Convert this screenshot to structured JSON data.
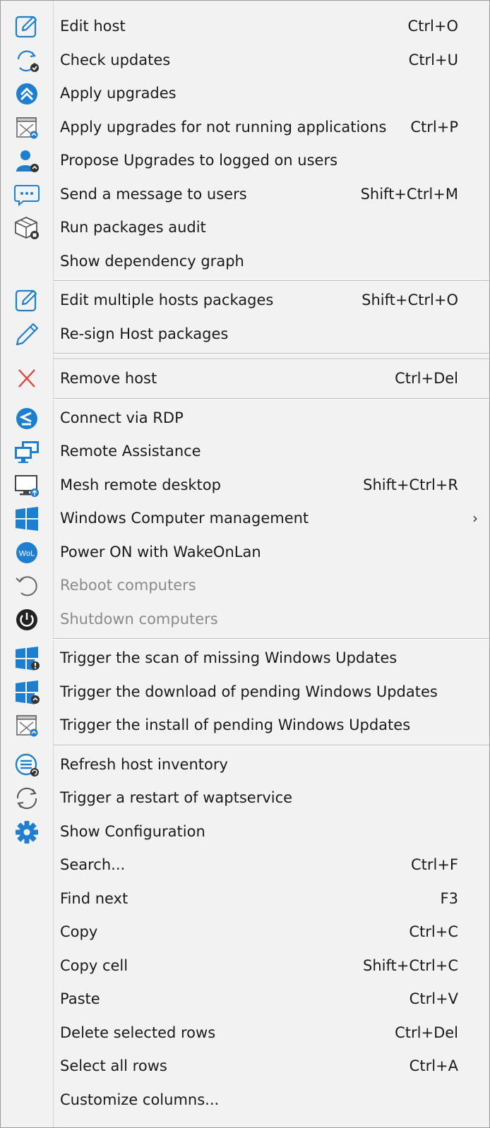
{
  "menu": {
    "items": [
      {
        "label": "Edit host",
        "shortcut": "Ctrl+O",
        "icon": "edit-icon"
      },
      {
        "label": "Check updates",
        "shortcut": "Ctrl+U",
        "icon": "check-updates-icon"
      },
      {
        "label": "Apply upgrades",
        "shortcut": "",
        "icon": "apply-upgrades-icon"
      },
      {
        "label": "Apply upgrades for not running applications",
        "shortcut": "Ctrl+P",
        "icon": "window-upgrade-icon"
      },
      {
        "label": "Propose Upgrades to logged on users",
        "shortcut": "",
        "icon": "user-upgrade-icon"
      },
      {
        "label": "Send a message to users",
        "shortcut": "Shift+Ctrl+M",
        "icon": "message-icon"
      },
      {
        "label": "Run packages audit",
        "shortcut": "",
        "icon": "package-audit-icon"
      },
      {
        "label": "Show dependency graph",
        "shortcut": "",
        "icon": ""
      },
      {
        "label": "Edit multiple hosts packages",
        "shortcut": "Shift+Ctrl+O",
        "icon": "edit-icon"
      },
      {
        "label": "Re-sign Host packages",
        "shortcut": "",
        "icon": "pencil-icon"
      },
      {
        "label": "Remove host",
        "shortcut": "Ctrl+Del",
        "icon": "remove-icon"
      },
      {
        "label": "Connect via RDP",
        "shortcut": "",
        "icon": "rdp-icon"
      },
      {
        "label": "Remote Assistance",
        "shortcut": "",
        "icon": "remote-assistance-icon"
      },
      {
        "label": "Mesh remote desktop",
        "shortcut": "Shift+Ctrl+R",
        "icon": "mesh-desktop-icon"
      },
      {
        "label": "Windows Computer management",
        "shortcut": "",
        "icon": "windows-icon",
        "submenu": "›"
      },
      {
        "label": "Power ON with WakeOnLan",
        "shortcut": "",
        "icon": "wol-icon",
        "icon_text": "WoL"
      },
      {
        "label": "Reboot computers",
        "shortcut": "",
        "icon": "reboot-icon",
        "disabled": true
      },
      {
        "label": "Shutdown computers",
        "shortcut": "",
        "icon": "power-icon",
        "disabled": true
      },
      {
        "label": "Trigger the scan of missing Windows Updates",
        "shortcut": "",
        "icon": "windows-scan-icon"
      },
      {
        "label": "Trigger the download of pending Windows Updates",
        "shortcut": "",
        "icon": "windows-download-icon"
      },
      {
        "label": "Trigger the install of pending Windows Updates",
        "shortcut": "",
        "icon": "window-upgrade-icon"
      },
      {
        "label": "Refresh host inventory",
        "shortcut": "",
        "icon": "refresh-inventory-icon"
      },
      {
        "label": "Trigger a restart of waptservice",
        "shortcut": "",
        "icon": "restart-icon"
      },
      {
        "label": "Show Configuration",
        "shortcut": "",
        "icon": "gear-icon"
      },
      {
        "label": "Search...",
        "shortcut": "Ctrl+F",
        "icon": ""
      },
      {
        "label": "Find next",
        "shortcut": "F3",
        "icon": ""
      },
      {
        "label": "Copy",
        "shortcut": "Ctrl+C",
        "icon": ""
      },
      {
        "label": "Copy cell",
        "shortcut": "Shift+Ctrl+C",
        "icon": ""
      },
      {
        "label": "Paste",
        "shortcut": "Ctrl+V",
        "icon": ""
      },
      {
        "label": "Delete selected rows",
        "shortcut": "Ctrl+Del",
        "icon": ""
      },
      {
        "label": "Select all rows",
        "shortcut": "Ctrl+A",
        "icon": ""
      },
      {
        "label": "Customize columns...",
        "shortcut": "",
        "icon": ""
      }
    ]
  },
  "colors": {
    "accent": "#1e7fd0",
    "remove": "#e0443a",
    "disabled_text": "#8a8a8a"
  }
}
